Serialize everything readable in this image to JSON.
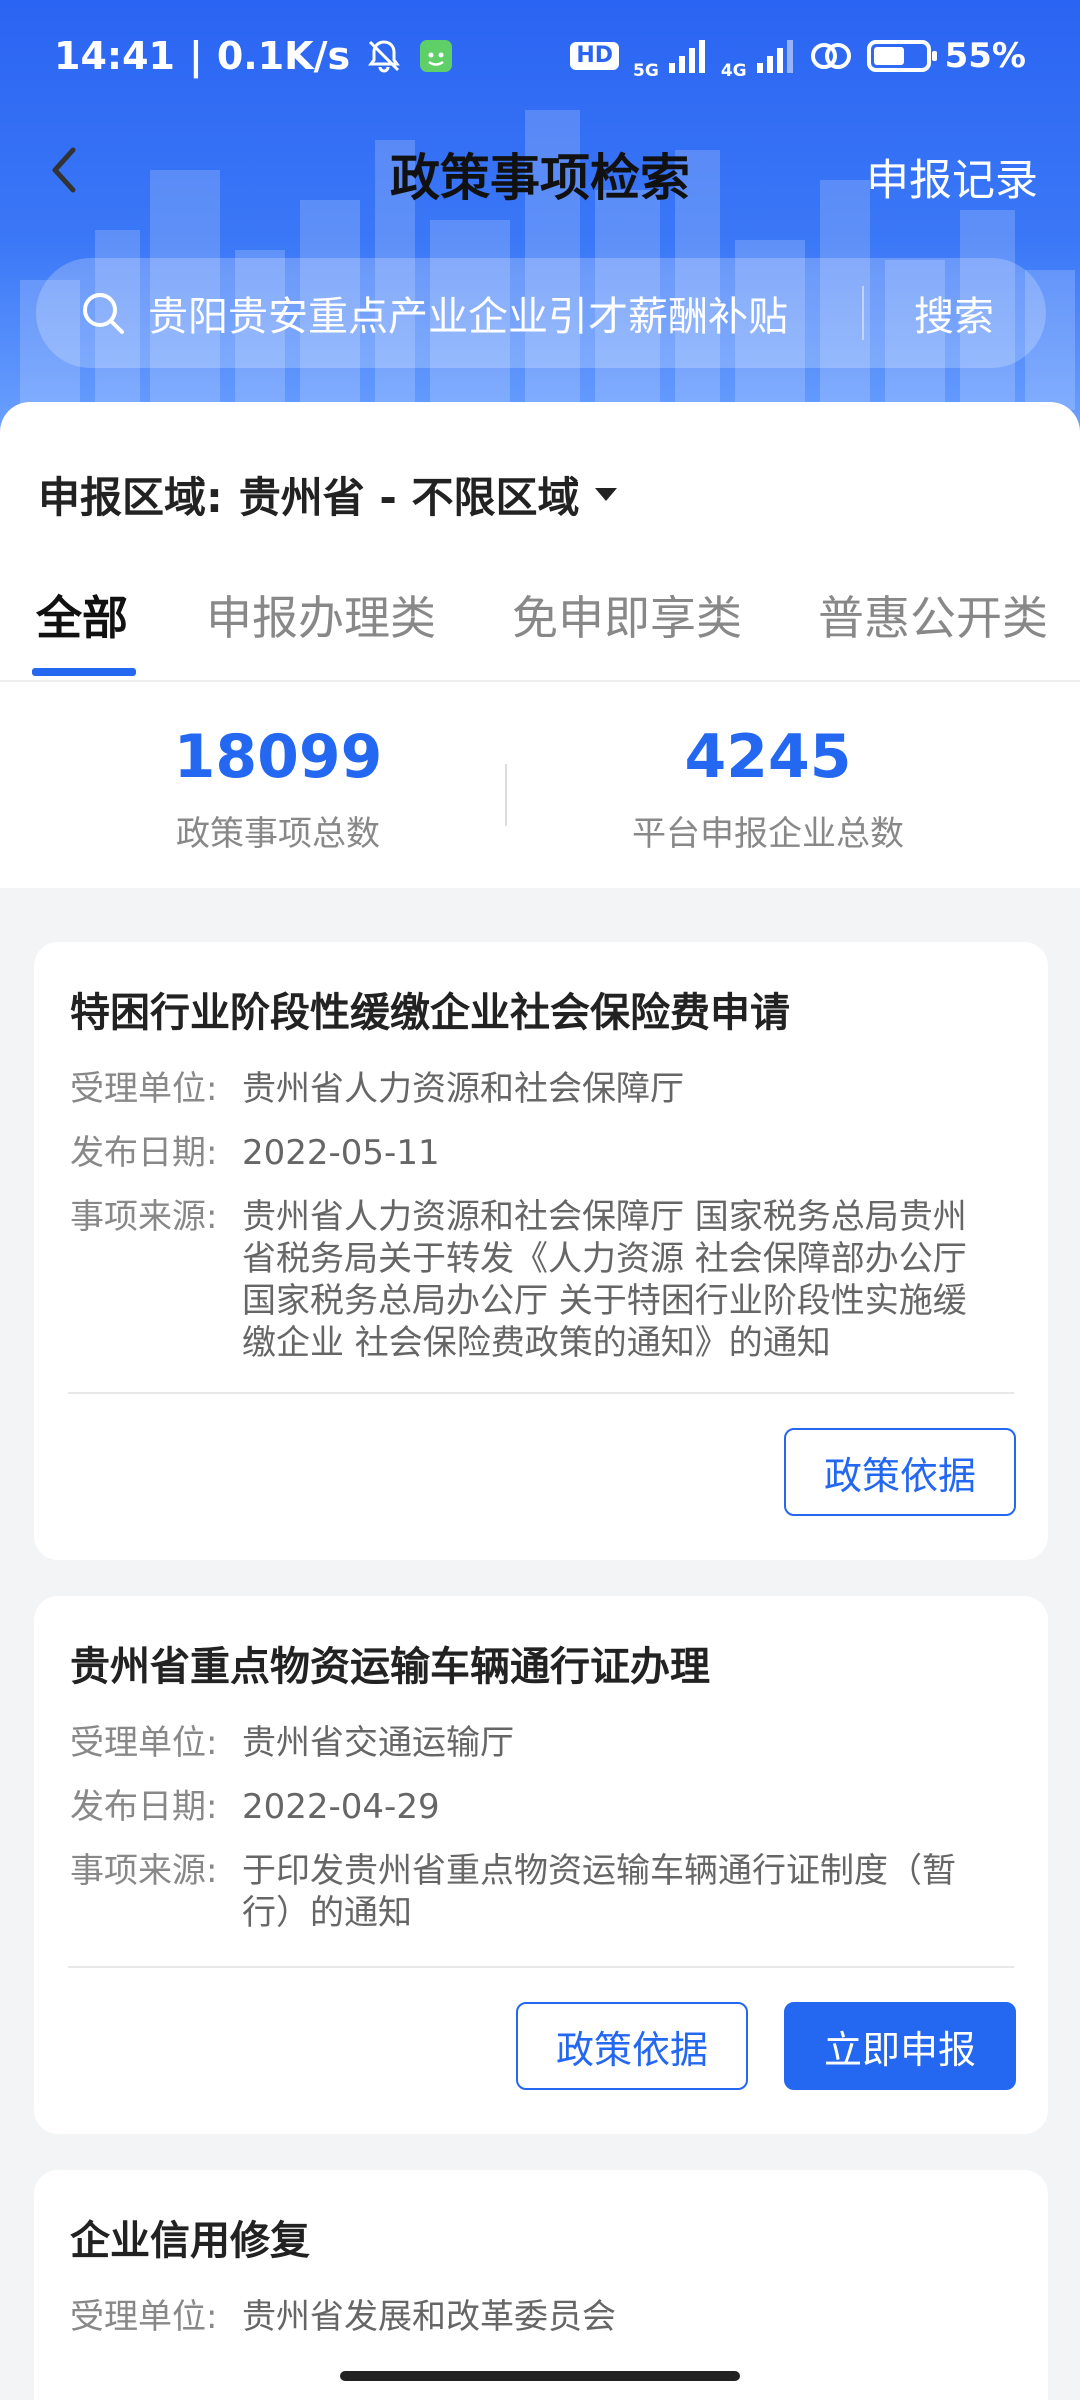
{
  "status_bar": {
    "time": "14:41",
    "net_speed": "0.1K/s",
    "hd_badge": "HD",
    "network_1": "5G",
    "network_2": "4G",
    "battery": "55%"
  },
  "header": {
    "back_icon": "chevron-left-icon",
    "title": "政策事项检索",
    "records_link": "申报记录"
  },
  "search": {
    "value": "贵阳贵安重点产业企业引才薪酬补贴",
    "button": "搜索"
  },
  "filter": {
    "label": "申报区域:",
    "value": "贵州省 - 不限区域"
  },
  "tabs": [
    {
      "label": "全部",
      "active": true
    },
    {
      "label": "申报办理类",
      "active": false
    },
    {
      "label": "免申即享类",
      "active": false
    },
    {
      "label": "普惠公开类",
      "active": false
    }
  ],
  "stats": [
    {
      "value": "18099",
      "label": "政策事项总数"
    },
    {
      "value": "4245",
      "label": "平台申报企业总数"
    }
  ],
  "meta_keys": {
    "unit": "受理单位:",
    "date": "发布日期:",
    "source": "事项来源:"
  },
  "cards": [
    {
      "title": "特困行业阶段性缓缴企业社会保险费申请",
      "unit": "贵州省人力资源和社会保障厅",
      "date": "2022-05-11",
      "source_lines": [
        "贵州省人力资源和社会保障厅 国家税务总局贵州",
        "省税务局关于转发《人力资源 社会保障部办公厅",
        "国家税务总局办公厅 关于特困行业阶段性实施缓",
        "缴企业 社会保险费政策的通知》的通知"
      ],
      "buttons": [
        "政策依据"
      ]
    },
    {
      "title": "贵州省重点物资运输车辆通行证办理",
      "unit": "贵州省交通运输厅",
      "date": "2022-04-29",
      "source_lines": [
        "于印发贵州省重点物资运输车辆通行证制度（暂",
        "行）的通知"
      ],
      "buttons": [
        "政策依据",
        "立即申报"
      ]
    },
    {
      "title": "企业信用修复",
      "unit": "贵州省发展和改革委员会"
    }
  ],
  "colors": {
    "primary": "#2468f2",
    "header_top": "#2a64f2"
  }
}
